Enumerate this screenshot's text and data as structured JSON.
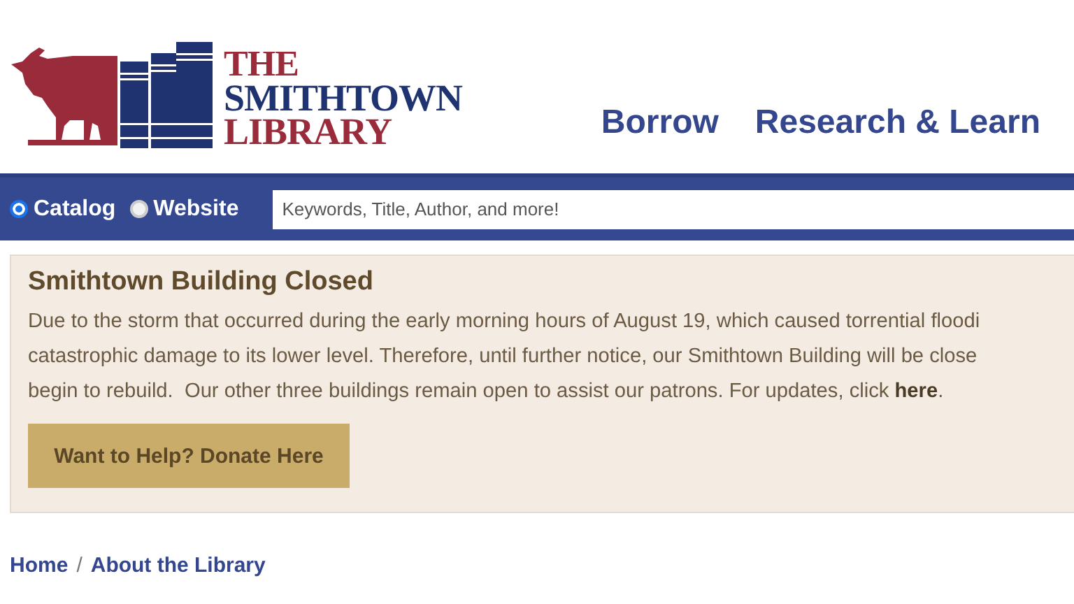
{
  "logo": {
    "lines": [
      "THE",
      "SMITHTOWN",
      "LIBRARY"
    ]
  },
  "nav": [
    "Borrow",
    "Research & Learn"
  ],
  "search": {
    "scopes": [
      {
        "label": "Catalog",
        "selected": true
      },
      {
        "label": "Website",
        "selected": false
      }
    ],
    "placeholder": "Keywords, Title, Author, and more!"
  },
  "alert": {
    "title": "Smithtown Building Closed",
    "lines": [
      "Due to the storm that occurred during the early morning hours of August 19, which caused torrential floodi",
      "catastrophic damage to its lower level. Therefore, until further notice, our Smithtown Building will be close",
      "begin to rebuild.  Our other three buildings remain open to assist our patrons. For updates, click"
    ],
    "link": "here",
    "tail": ".",
    "button": "Want to Help? Donate Here"
  },
  "breadcrumb": [
    {
      "label": "Home"
    },
    {
      "label": "About the Library"
    }
  ],
  "breadcrumb_separator": "/"
}
